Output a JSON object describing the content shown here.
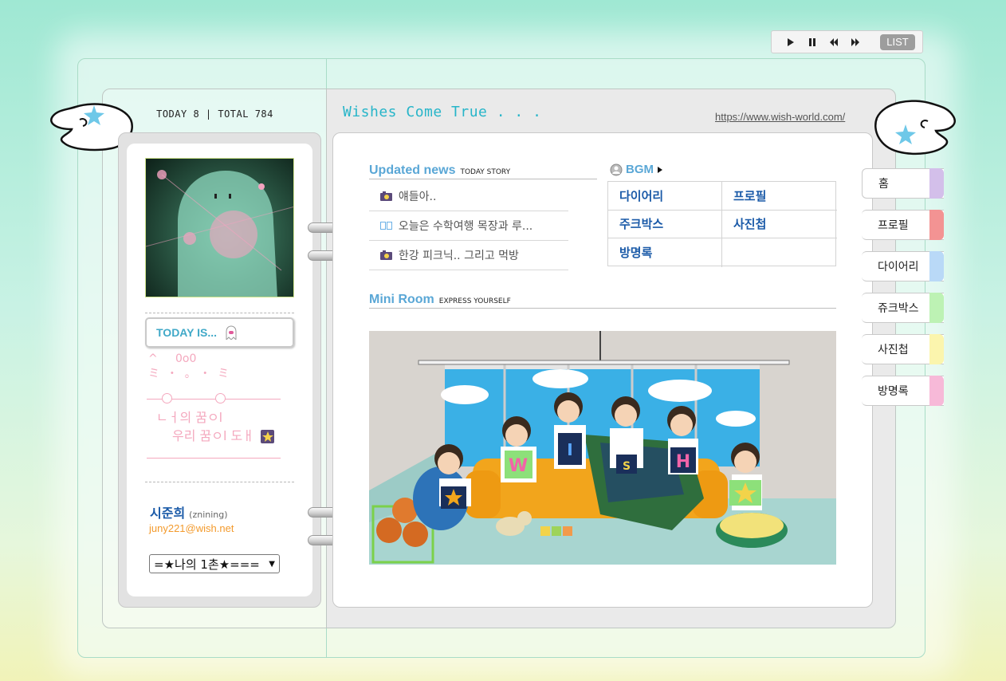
{
  "player": {
    "list_label": "LIST"
  },
  "header": {
    "today_total": "TODAY 8 | TOTAL 784",
    "title": "Wishes Come True . . .",
    "url": "https://www.wish-world.com/"
  },
  "profile": {
    "today_is_label": "TODAY IS...",
    "deco_line1": "^     0o0",
    "deco_line2": "ミ  ・  。 ・  ミ",
    "dream_line1": "ㄴㅓ의 꿈ㅇl",
    "dream_line2": "우리 꿈ㅇl 도ㅐ",
    "name": "시준희",
    "user_id": "(znining)",
    "email": "juny221@wish.net",
    "ilchon_select": "=★나의 1촌★==="
  },
  "updated_news": {
    "title": "Updated news",
    "subtitle": "TODAY STORY",
    "items": [
      {
        "text": "얘들아..",
        "icon": "camera-icon"
      },
      {
        "text": "오늘은 수학여행 목장과 루...",
        "icon": "book-icon"
      },
      {
        "text": "한강 피크닉.. 그리고 먹방",
        "icon": "camera-icon"
      }
    ]
  },
  "bgm": {
    "label": "BGM"
  },
  "menu": {
    "items": [
      "다이어리",
      "프로필",
      "주크박스",
      "사진첩",
      "방명록",
      ""
    ]
  },
  "mini_room": {
    "title": "Mini Room",
    "subtitle": "EXPRESS YOURSELF",
    "letters": [
      "W",
      "I",
      "S",
      "H"
    ]
  },
  "tabs": [
    {
      "label": "홈",
      "color": "#d3bfea"
    },
    {
      "label": "프로필",
      "color": "#f39393"
    },
    {
      "label": "다이어리",
      "color": "#b9d9f7"
    },
    {
      "label": "쥬크박스",
      "color": "#bdf2b4"
    },
    {
      "label": "사진첩",
      "color": "#fbf5ad"
    },
    {
      "label": "방명록",
      "color": "#f7b9d8"
    }
  ]
}
